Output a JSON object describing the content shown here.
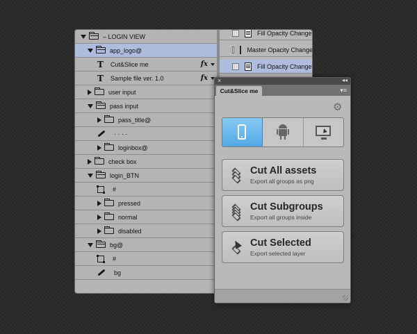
{
  "layers": [
    {
      "label": "– LOGIN VIEW",
      "indent": 0,
      "kind": "folder",
      "state": "open"
    },
    {
      "label": "app_logo@",
      "indent": 1,
      "kind": "folder",
      "state": "open",
      "selected": true
    },
    {
      "label": "Cut&Slice me",
      "indent": 2,
      "kind": "text",
      "fx": "fx"
    },
    {
      "label": "Sample file ver. 1.0",
      "indent": 2,
      "kind": "text",
      "fx": "fx"
    },
    {
      "label": "user input",
      "indent": 1,
      "kind": "folder",
      "state": "closed"
    },
    {
      "label": "pass input",
      "indent": 1,
      "kind": "folder",
      "state": "open"
    },
    {
      "label": "pass_title@",
      "indent": 2,
      "kind": "folder",
      "state": "closed"
    },
    {
      "label": "· · · ·",
      "indent": 2,
      "kind": "brush"
    },
    {
      "label": "loginbox@",
      "indent": 2,
      "kind": "folder",
      "state": "closed"
    },
    {
      "label": "check box",
      "indent": 1,
      "kind": "folder",
      "state": "closed"
    },
    {
      "label": "login_BTN",
      "indent": 1,
      "kind": "folder",
      "state": "open"
    },
    {
      "label": "#",
      "indent": 2,
      "kind": "shape"
    },
    {
      "label": "pressed",
      "indent": 2,
      "kind": "folder",
      "state": "closed"
    },
    {
      "label": "normal",
      "indent": 2,
      "kind": "folder",
      "state": "closed"
    },
    {
      "label": "disabled",
      "indent": 2,
      "kind": "folder",
      "state": "closed"
    },
    {
      "label": "bg@",
      "indent": 1,
      "kind": "folder",
      "state": "open"
    },
    {
      "label": "#",
      "indent": 2,
      "kind": "shape"
    },
    {
      "label": "bg",
      "indent": 2,
      "kind": "brush"
    }
  ],
  "history": [
    {
      "label": "Fill Opacity Change",
      "selected": false
    },
    {
      "label": "Master Opacity Change",
      "selected": false
    },
    {
      "label": "Fill Opacity Change",
      "selected": true
    }
  ],
  "panel": {
    "close": "×",
    "collapse": "◂◂",
    "tab": "Cut&Slice me",
    "menu": "▾≡",
    "gear": "⚙"
  },
  "platforms": [
    "iOS",
    "Android",
    "Desktop"
  ],
  "actions": [
    {
      "title": "Cut All assets",
      "subtitle": "Export all groups as png"
    },
    {
      "title": "Cut Subgroups",
      "subtitle": "Export all groups inside"
    },
    {
      "title": "Cut Selected",
      "subtitle": "Export selected layer"
    }
  ],
  "colors": {
    "selection": "#aebdde",
    "platform_active": "#52a8e6"
  }
}
